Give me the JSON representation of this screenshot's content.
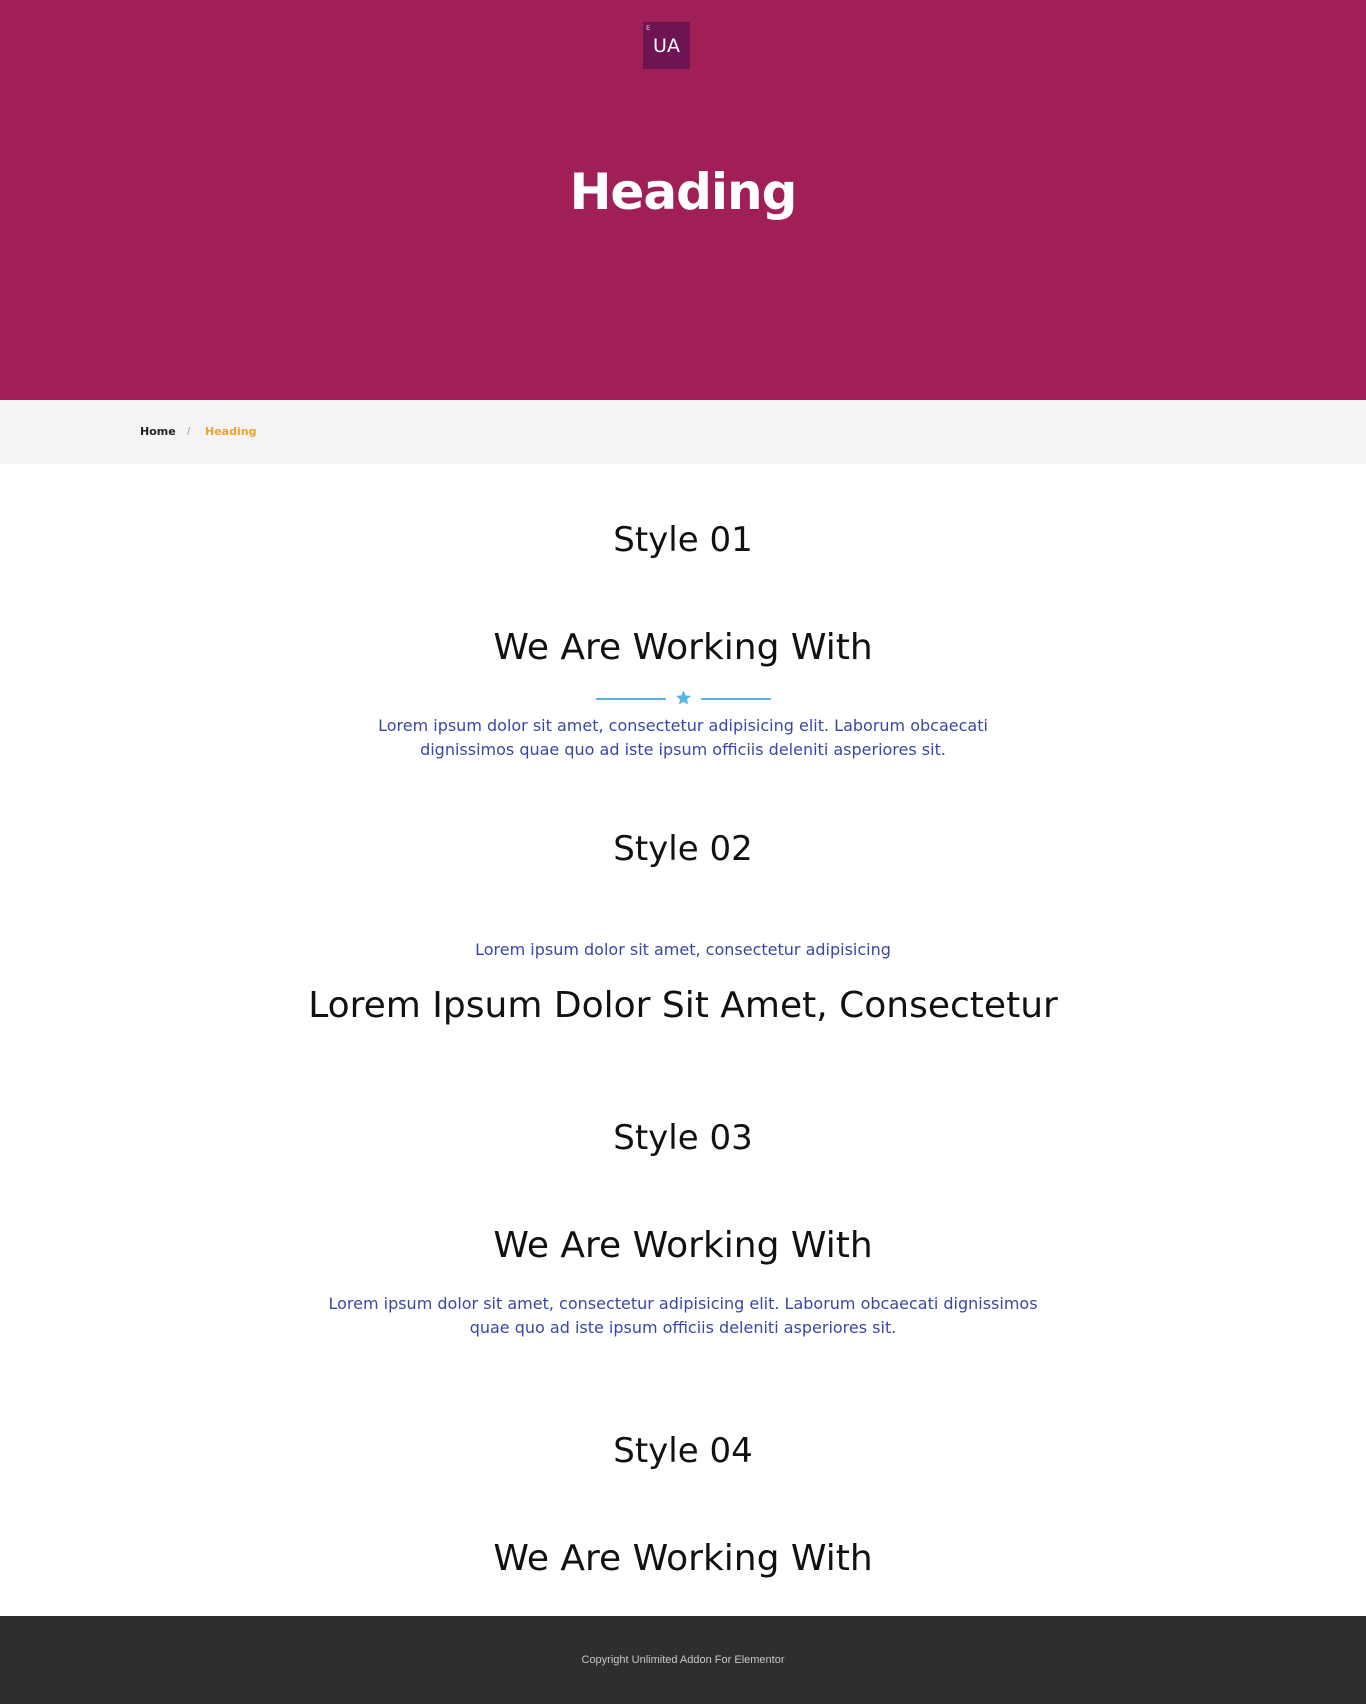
{
  "header": {
    "logo_text": "UA",
    "logo_mark": "E",
    "title": "Heading"
  },
  "breadcrumb": {
    "home": "Home",
    "separator": "/",
    "current": "Heading"
  },
  "sections": [
    {
      "style_label": "Style 01",
      "heading": "We Are Working With",
      "divider_icon": "star-icon",
      "text": "Lorem ipsum dolor sit amet, consectetur adipisicing elit. Laborum obcaecati dignissimos quae quo ad iste ipsum officiis deleniti asperiores sit."
    },
    {
      "style_label": "Style 02",
      "subtitle": "Lorem ipsum dolor sit amet, consectetur adipisicing",
      "heading": "Lorem Ipsum Dolor Sit Amet, Consectetur"
    },
    {
      "style_label": "Style 03",
      "heading": "We Are Working With",
      "text": "Lorem ipsum dolor sit amet, consectetur adipisicing elit. Laborum obcaecati dignissimos quae quo ad iste ipsum officiis deleniti asperiores sit."
    },
    {
      "style_label": "Style 04",
      "heading": "We Are Working With"
    }
  ],
  "footer": {
    "copyright": "Copyright Unlimited Addon For Elementor"
  },
  "colors": {
    "hero_bg": "#a01f57",
    "logo_bg": "#6e1453",
    "breadcrumb_active": "#f1a12d",
    "paragraph": "#3a46a8",
    "divider": "#59b4e2",
    "footer_bg": "#2e2e2e"
  }
}
